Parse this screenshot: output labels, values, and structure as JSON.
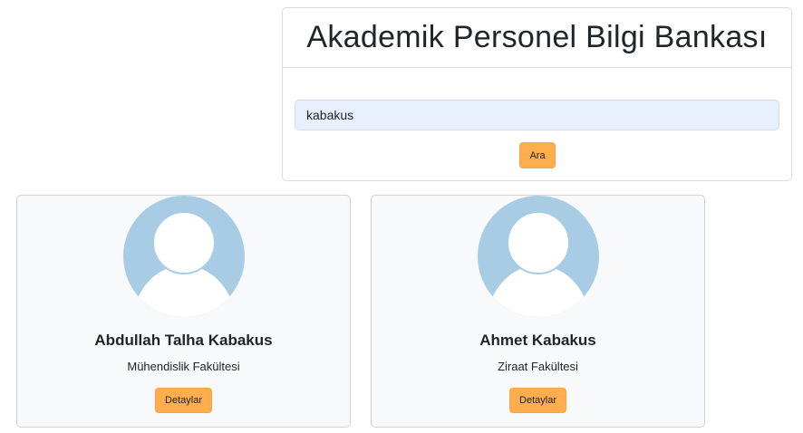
{
  "header": {
    "title": "Akademik Personel Bilgi Bankası"
  },
  "search": {
    "value": "kabakus",
    "button_label": "Ara"
  },
  "results": [
    {
      "name": "Abdullah Talha Kabakus",
      "faculty": "Mühendislik Fakültesi",
      "button_label": "Detaylar"
    },
    {
      "name": "Ahmet Kabakus",
      "faculty": "Ziraat Fakültesi",
      "button_label": "Detaylar"
    }
  ],
  "colors": {
    "accent": "#ffad4d",
    "avatar_bg": "#a8cce4",
    "input_bg": "#e8f0fe"
  },
  "icons": {
    "avatar": "user-avatar-icon"
  }
}
